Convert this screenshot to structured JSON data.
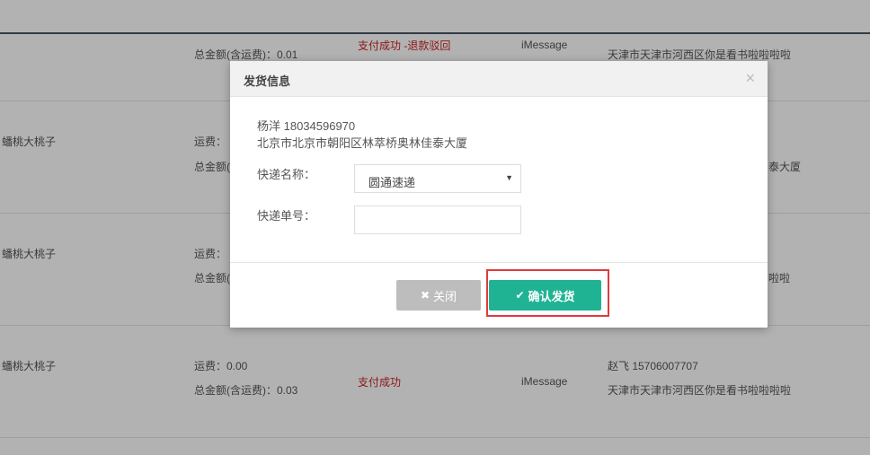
{
  "rows": [
    {
      "product": "",
      "shipping": "",
      "total": "总金额(含运费)：0.01",
      "status": "支付成功 -退款驳回",
      "payment": "iMessage",
      "contact": "",
      "address": "天津市天津市河西区你是看书啦啦啦啦"
    },
    {
      "product": "蟠桃大桃子",
      "shipping": "运费：",
      "total": "总金额(",
      "status": "",
      "payment": "",
      "contact": "",
      "address": "泰大厦"
    },
    {
      "product": "蟠桃大桃子",
      "shipping": "运费：",
      "total": "总金额(",
      "status": "",
      "payment": "",
      "contact": "",
      "address": "啦啦"
    },
    {
      "product": "蟠桃大桃子",
      "shipping": "运费：0.00",
      "total": "总金额(含运费)：0.03",
      "status": "支付成功",
      "payment": "iMessage",
      "contact": "赵飞 15706007707",
      "address": "天津市天津市河西区你是看书啦啦啦啦"
    }
  ],
  "modal": {
    "title": "发货信息",
    "close_symbol": "×",
    "recipient": "杨洋 18034596970",
    "address": "北京市北京市朝阳区林萃桥奥林佳泰大厦",
    "courier_label": "快递名称：",
    "courier_value": "圆通速递",
    "tracking_label": "快递单号：",
    "tracking_value": "",
    "close_button": "关闭",
    "confirm_button": "确认发货"
  },
  "colors": {
    "confirm": "#1fb394",
    "close": "#bdbdbd",
    "highlight": "#e03b3b",
    "status_red": "#cc2222"
  },
  "icons": {
    "close_button_icon": "times-icon",
    "confirm_button_icon": "check-icon",
    "select_icon": "caret-down-icon"
  }
}
